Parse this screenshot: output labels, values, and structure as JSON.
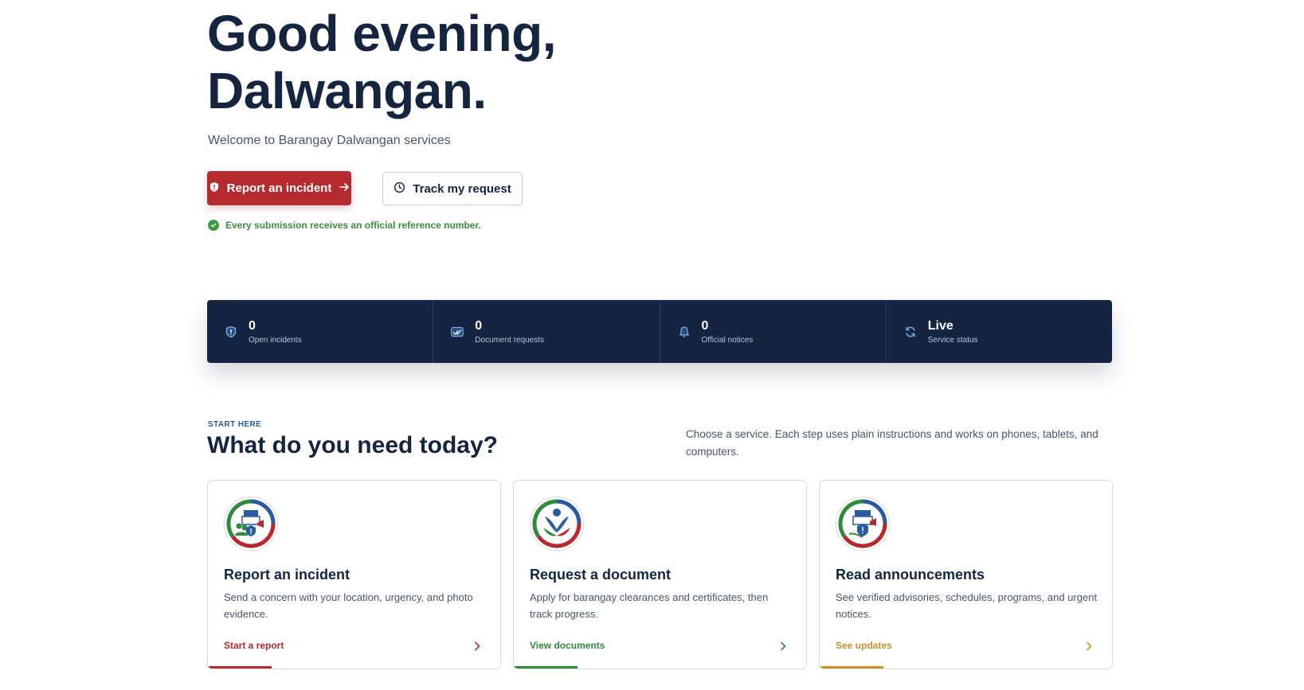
{
  "hero": {
    "title_line1": "Good evening,",
    "title_line2": "Dalwangan.",
    "subtitle": "Welcome to Barangay Dalwangan services",
    "primary_button": "Report an incident",
    "secondary_button": "Track my request",
    "note": "Every submission receives an official reference number."
  },
  "stats": [
    {
      "value": "0",
      "label": "Open incidents",
      "icon": "shield-icon"
    },
    {
      "value": "0",
      "label": "Document requests",
      "icon": "checks-icon"
    },
    {
      "value": "0",
      "label": "Official notices",
      "icon": "bell-icon"
    },
    {
      "value": "Live",
      "label": "Service status",
      "icon": "refresh-icon"
    }
  ],
  "section": {
    "eyebrow": "START HERE",
    "title": "What do you need today?",
    "description": "Choose a service. Each step uses plain instructions and works on phones, tablets, and computers."
  },
  "cards": [
    {
      "title": "Report an incident",
      "description": "Send a concern with your location, urgency, and photo evidence.",
      "link": "Start a report",
      "color": "#b52a2f"
    },
    {
      "title": "Request a document",
      "description": "Apply for barangay clearances and certificates, then track progress.",
      "link": "View documents",
      "color": "#2f8a3c"
    },
    {
      "title": "Read announcements",
      "description": "See verified advisories, schedules, programs, and urgent notices.",
      "link": "See updates",
      "color": "#c7922a"
    }
  ],
  "colors": {
    "brand_navy": "#142441",
    "brand_red": "#b52a2f",
    "brand_green": "#2f8a3c",
    "brand_gold": "#c7922a",
    "brand_blue": "#2b5aa0"
  }
}
